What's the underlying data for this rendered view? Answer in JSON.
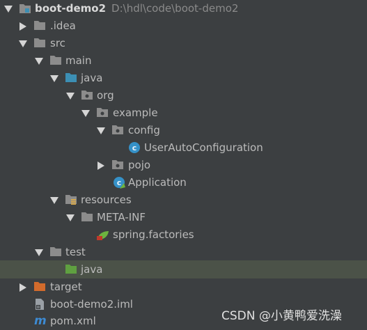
{
  "tree": {
    "root": {
      "name": "boot-demo2",
      "path": "D:\\hdl\\code\\boot-demo2"
    },
    "idea": ".idea",
    "src": "src",
    "main": "main",
    "main_java": "java",
    "org": "org",
    "example": "example",
    "config": "config",
    "user_auto_config": "UserAutoConfiguration",
    "pojo": "pojo",
    "application": "Application",
    "resources": "resources",
    "meta_inf": "META-INF",
    "spring_factories": "spring.factories",
    "test": "test",
    "test_java": "java",
    "target": "target",
    "iml": "boot-demo2.iml",
    "pom": "pom.xml"
  },
  "watermark": "CSDN @小黄鸭爱洗澡",
  "colors": {
    "background": "#3c3f41",
    "selection": "#4b5248",
    "folder_gray": "#8c8c8c",
    "folder_blue": "#3c8fb4",
    "folder_green": "#5fa040",
    "folder_orange": "#d26b2c",
    "class_icon": "#3591c8"
  }
}
